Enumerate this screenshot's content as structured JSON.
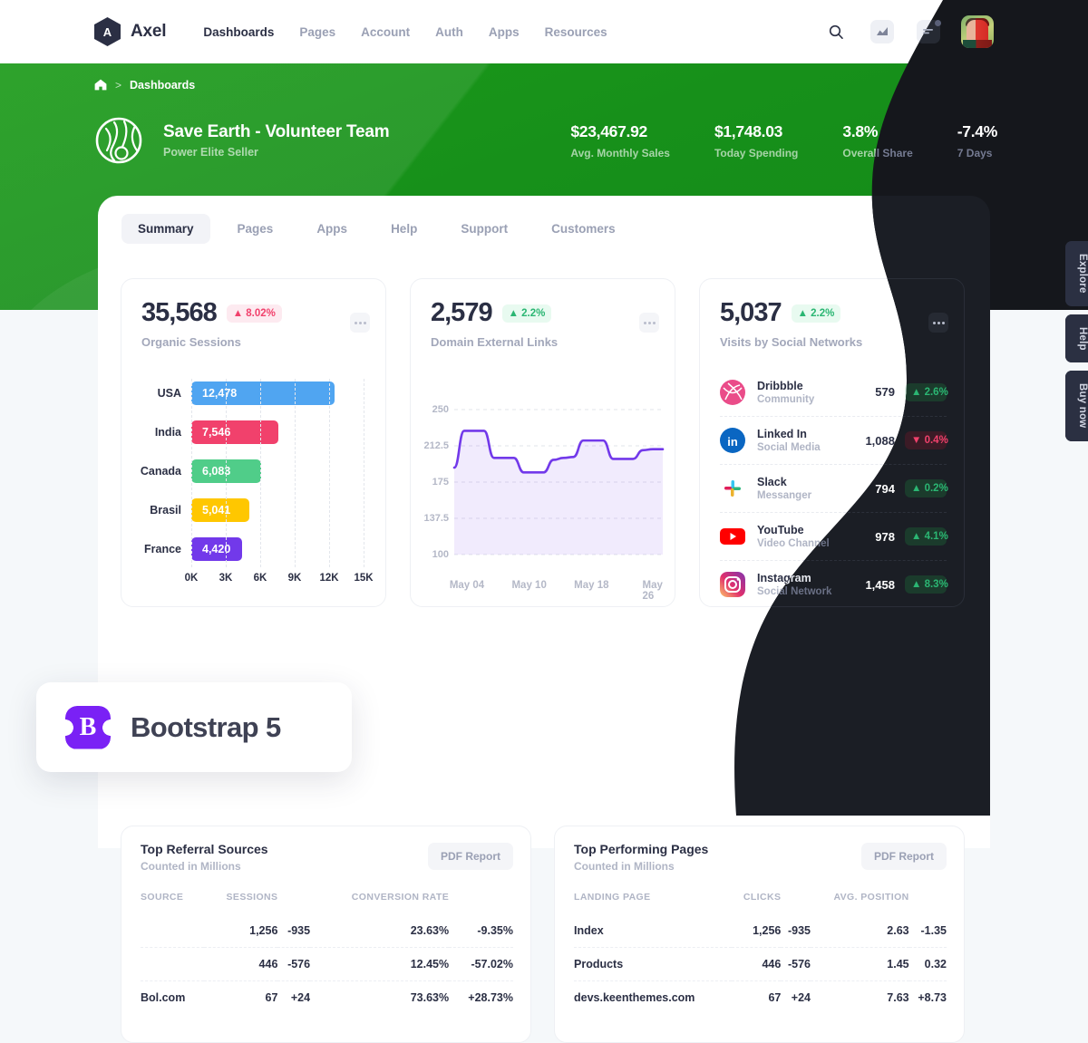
{
  "header": {
    "brand_initial": "A",
    "brand_name": "Axel",
    "nav": [
      {
        "label": "Dashboards",
        "active": true
      },
      {
        "label": "Pages",
        "active": false
      },
      {
        "label": "Account",
        "active": false
      },
      {
        "label": "Auth",
        "active": false
      },
      {
        "label": "Apps",
        "active": false
      },
      {
        "label": "Resources",
        "active": false
      }
    ],
    "icons": [
      "search-icon",
      "chart-icon",
      "notifications-icon"
    ]
  },
  "hero": {
    "breadcrumb_home": "home-icon",
    "breadcrumb_sep": ">",
    "breadcrumb_text": "Dashboards",
    "title": "Save Earth - Volunteer Team",
    "subtitle": "Power Elite Seller",
    "accent_green": "#17901a",
    "stats": [
      {
        "value": "$23,467.92",
        "label": "Avg. Monthly Sales"
      },
      {
        "value": "$1,748.03",
        "label": "Today Spending"
      },
      {
        "value": "3.8%",
        "label": "Overall Share"
      },
      {
        "value": "-7.4%",
        "label": "7 Days"
      }
    ]
  },
  "tabs": [
    {
      "label": "Summary",
      "active": true
    },
    {
      "label": "Pages",
      "active": false
    },
    {
      "label": "Apps",
      "active": false
    },
    {
      "label": "Help",
      "active": false
    },
    {
      "label": "Support",
      "active": false
    },
    {
      "label": "Customers",
      "active": false
    }
  ],
  "widget_bar": {
    "kpi": "35,568",
    "badge": "8.02%",
    "badge_dir": "up",
    "badge_tone": "down",
    "subtitle": "Organic Sessions"
  },
  "widget_line": {
    "kpi": "2,579",
    "badge": "2.2%",
    "badge_dir": "up",
    "subtitle": "Domain External Links"
  },
  "widget_social": {
    "kpi": "5,037",
    "badge": "2.2%",
    "badge_dir": "up",
    "subtitle": "Visits by Social Networks",
    "rows": [
      {
        "name": "Dribbble",
        "desc": "Community",
        "value": "579",
        "delta": "2.6%",
        "dir": "up",
        "color": "#e84d8a",
        "icon": "dribbble-icon"
      },
      {
        "name": "Linked In",
        "desc": "Social Media",
        "value": "1,088",
        "delta": "0.4%",
        "dir": "down",
        "color": "#0a66c2",
        "icon": "linkedin-icon"
      },
      {
        "name": "Slack",
        "desc": "Messanger",
        "value": "794",
        "delta": "0.2%",
        "dir": "up",
        "color": "#ffffff",
        "icon": "slack-icon"
      },
      {
        "name": "YouTube",
        "desc": "Video Channel",
        "value": "978",
        "delta": "4.1%",
        "dir": "up",
        "color": "#ff0000",
        "icon": "youtube-icon"
      },
      {
        "name": "Instagram",
        "desc": "Social Network",
        "value": "1,458",
        "delta": "8.3%",
        "dir": "up",
        "color": "#e1306c",
        "icon": "instagram-icon"
      }
    ]
  },
  "table_referral": {
    "title": "Top Referral Sources",
    "subtitle": "Counted in Millions",
    "button": "PDF Report",
    "columns": [
      "SOURCE",
      "SESSIONS",
      "",
      "CONVERSION RATE",
      ""
    ],
    "header_visible": [
      "",
      "SESSIONS",
      "",
      "CONVERSION RATE",
      ""
    ],
    "rows": [
      {
        "cells": [
          "",
          "1,256",
          "-935",
          "23.63%",
          "-9.35%"
        ],
        "tones": [
          "",
          "",
          "neg",
          "",
          "neg"
        ]
      },
      {
        "cells": [
          "",
          "446",
          "-576",
          "12.45%",
          "-57.02%"
        ],
        "tones": [
          "",
          "",
          "neg",
          "",
          "neg"
        ]
      },
      {
        "cells": [
          "Bol.com",
          "67",
          "+24",
          "73.63%",
          "+28.73%"
        ],
        "tones": [
          "",
          "",
          "pos",
          "",
          "pos"
        ]
      }
    ]
  },
  "table_pages": {
    "title": "Top Performing Pages",
    "subtitle": "Counted in Millions",
    "button": "PDF Report",
    "columns": [
      "LANDING PAGE",
      "CLICKS",
      "",
      "AVG. POSITION",
      ""
    ],
    "rows": [
      {
        "cells": [
          "Index",
          "1,256",
          "-935",
          "2.63",
          "-1.35"
        ],
        "tones": [
          "",
          "",
          "neg",
          "",
          "neg"
        ]
      },
      {
        "cells": [
          "Products",
          "446",
          "-576",
          "1.45",
          "0.32"
        ],
        "tones": [
          "",
          "",
          "neg",
          "",
          "neg"
        ]
      },
      {
        "cells": [
          "devs.keenthemes.com",
          "67",
          "+24",
          "7.63",
          "+8.73"
        ],
        "tones": [
          "",
          "",
          "pos",
          "",
          "pos"
        ]
      }
    ]
  },
  "rail": [
    {
      "label": "Explore"
    },
    {
      "label": "Help"
    },
    {
      "label": "Buy now"
    }
  ],
  "promo": {
    "logo_letter": "B",
    "text": "Bootstrap 5",
    "logo_color": "#7a21f5"
  },
  "chart_data": [
    {
      "type": "bar",
      "title": "Organic Sessions",
      "orientation": "horizontal",
      "categories": [
        "USA",
        "India",
        "Canada",
        "Brasil",
        "France"
      ],
      "values": [
        12478,
        7546,
        6083,
        5041,
        4420
      ],
      "value_labels": [
        "12,478",
        "7,546",
        "6,083",
        "5,041",
        "4,420"
      ],
      "colors": [
        "#50a5f1",
        "#f1416c",
        "#50cd89",
        "#ffc700",
        "#7239ea"
      ],
      "xlabel": "",
      "ylabel": "",
      "xticks": [
        "0K",
        "3K",
        "6K",
        "9K",
        "12K",
        "15K"
      ],
      "xlim": [
        0,
        15000
      ],
      "grid": true,
      "legend": "none"
    },
    {
      "type": "area",
      "title": "Domain External Links",
      "x": [
        "May 04",
        "May 10",
        "May 18",
        "May 26"
      ],
      "xticks": [
        "May 04",
        "May 10",
        "May 18",
        "May 26"
      ],
      "yticks": [
        "100",
        "137.5",
        "175",
        "212.5",
        "250"
      ],
      "ylim": [
        100,
        250
      ],
      "values": [
        190,
        228,
        228,
        228,
        200,
        200,
        200,
        185,
        185,
        185,
        198,
        200,
        201,
        218,
        218,
        218,
        199,
        199,
        199,
        208,
        209,
        209
      ],
      "line_color": "#7239ea",
      "fill_color": "#7239ea",
      "grid": true,
      "legend": "none"
    },
    {
      "type": "table",
      "title": "Visits by Social Networks",
      "categories": [
        "Dribbble",
        "Linked In",
        "Slack",
        "YouTube",
        "Instagram"
      ],
      "values": [
        579,
        1088,
        794,
        978,
        1458
      ],
      "deltas": [
        "+2.6%",
        "-0.4%",
        "+0.2%",
        "+4.1%",
        "+8.3%"
      ]
    }
  ]
}
